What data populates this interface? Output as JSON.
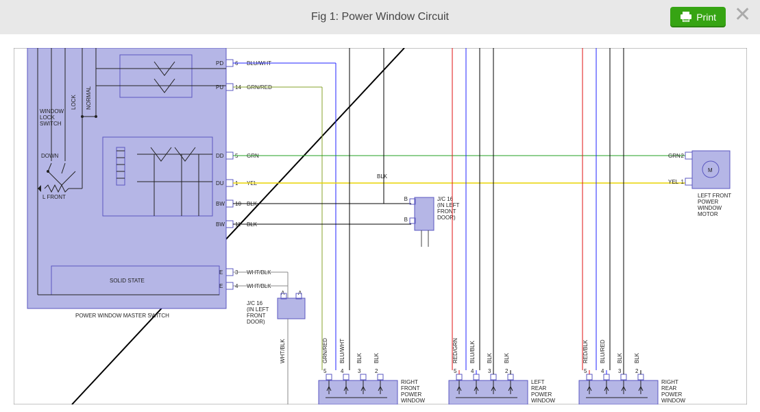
{
  "header": {
    "title": "Fig 1: Power Window Circuit",
    "print": "Print"
  },
  "master_switch": {
    "label": "POWER WINDOW MASTER SWITCH",
    "solid_state": "SOLID STATE",
    "lock_switch": "WINDOW\nLOCK\nSWITCH",
    "lock": "LOCK",
    "normal": "NORMAL",
    "down": "DOWN",
    "l_front": "L FRONT"
  },
  "pins": {
    "pd": {
      "tag": "PD",
      "num": "6",
      "wire": "BLU/WHT"
    },
    "pu": {
      "tag": "PU",
      "num": "14",
      "wire": "GRN/RED"
    },
    "dd": {
      "tag": "DD",
      "num": "5",
      "wire": "GRN"
    },
    "du": {
      "tag": "DU",
      "num": "1",
      "wire": "YEL"
    },
    "bw1": {
      "tag": "BW",
      "num": "10",
      "wire": "BLK"
    },
    "bw2": {
      "tag": "BW",
      "num": "11",
      "wire": "BLK"
    },
    "e1": {
      "tag": "E",
      "num": "3",
      "wire": "WHT/BLK"
    },
    "e2": {
      "tag": "E",
      "num": "4",
      "wire": "WHT/BLK"
    }
  },
  "jc16_top": {
    "label": "J/C 16\n(IN LEFT\nFRONT\nDOOR)",
    "pin": "B"
  },
  "jc16_bot": {
    "label": "J/C 16\n(IN LEFT\nFRONT\nDOOR)",
    "a": "A"
  },
  "motor": {
    "grn": {
      "wire": "GRN",
      "num": "2"
    },
    "yel": {
      "wire": "YEL",
      "num": "1"
    },
    "label": "LEFT FRONT\nPOWER\nWINDOW\nMOTOR"
  },
  "mid_blk": "BLK",
  "down_whtblk": "WHT/BLK",
  "controls": [
    {
      "label": "RIGHT\nFRONT\nPOWER\nWINDOW\nCONTROL",
      "cols": [
        {
          "n": "5",
          "w": "GRN/RED"
        },
        {
          "n": "4",
          "w": "BLU/WHT"
        },
        {
          "n": "3",
          "w": "BLK"
        },
        {
          "n": "2",
          "w": "BLK"
        }
      ]
    },
    {
      "label": "LEFT\nREAR\nPOWER\nWINDOW\nCONTROL",
      "cols": [
        {
          "n": "5",
          "w": "RED/GRN"
        },
        {
          "n": "4",
          "w": "BLU/BLK"
        },
        {
          "n": "3",
          "w": "BLK"
        },
        {
          "n": "2",
          "w": "BLK"
        }
      ]
    },
    {
      "label": "RIGHT\nREAR\nPOWER\nWINDOW\nCONTROL",
      "cols": [
        {
          "n": "5",
          "w": "RED/BLK"
        },
        {
          "n": "4",
          "w": "BLU/RED"
        },
        {
          "n": "3",
          "w": "BLK"
        },
        {
          "n": "2",
          "w": "BLK"
        }
      ]
    }
  ],
  "colors": {
    "blue": "#1f22ff",
    "green": "#1f9f1f",
    "olive": "#85a028",
    "yellow": "#f2e21a",
    "black": "#000",
    "grey": "#888",
    "red": "#e01010"
  }
}
